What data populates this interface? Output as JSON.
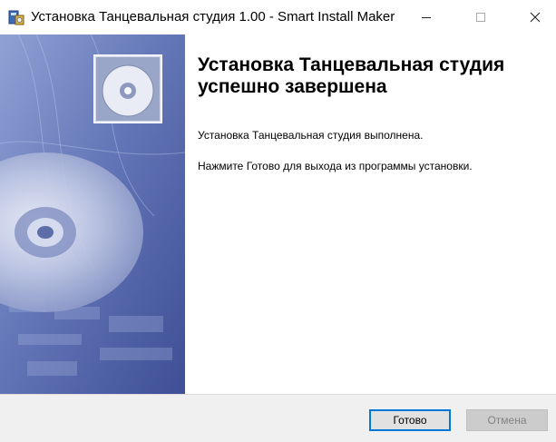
{
  "window": {
    "title": "Установка Танцевальная студия 1.00 - Smart Install Maker",
    "icon": "installer-icon",
    "controls": [
      "minimize-icon",
      "maximize-icon",
      "close-icon"
    ]
  },
  "wizard": {
    "heading": "Установка Танцевальная студия успешно завершена",
    "message_completed": "Установка Танцевальная студия выполнена.",
    "message_instruction": "Нажмите Готово для выхода из программы установки."
  },
  "buttons": {
    "finish_label": "Готово",
    "cancel_label": "Отмена"
  },
  "colors": {
    "accent": "#0078d7",
    "side_panel": "#5c6fb0",
    "footer": "#f0f0f0"
  }
}
